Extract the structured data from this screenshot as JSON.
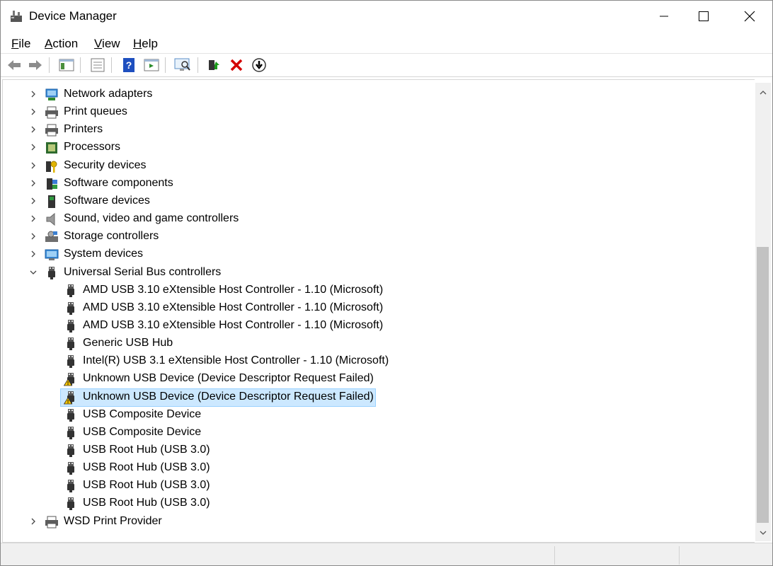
{
  "window": {
    "title": "Device Manager",
    "icon": "device-manager-icon",
    "controls": [
      "minimize",
      "maximize",
      "close"
    ]
  },
  "menu": {
    "file": {
      "label_ul": "F",
      "label_rest": "ile"
    },
    "action": {
      "label_ul": "A",
      "label_rest": "ction"
    },
    "view": {
      "label_ul": "V",
      "label_rest": "iew"
    },
    "help": {
      "label_ul": "H",
      "label_rest": "elp"
    }
  },
  "toolbar": {
    "buttons": [
      "back-icon",
      "forward-icon",
      "show-hide-console-tree-icon",
      "properties-icon",
      "help-icon",
      "action-pane-icon",
      "scan-hardware-icon",
      "update-driver-icon",
      "uninstall-icon",
      "disable-device-icon"
    ]
  },
  "tree": {
    "categories_above": [
      {
        "label": "Network adapters",
        "icon": "network-adapter-icon"
      },
      {
        "label": "Print queues",
        "icon": "printer-icon"
      },
      {
        "label": "Printers",
        "icon": "printer-icon"
      },
      {
        "label": "Processors",
        "icon": "processor-icon"
      },
      {
        "label": "Security devices",
        "icon": "security-key-icon"
      },
      {
        "label": "Software components",
        "icon": "software-component-icon"
      },
      {
        "label": "Software devices",
        "icon": "software-device-icon"
      },
      {
        "label": "Sound, video and game controllers",
        "icon": "speaker-icon"
      },
      {
        "label": "Storage controllers",
        "icon": "storage-controller-icon"
      },
      {
        "label": "System devices",
        "icon": "system-devices-icon"
      }
    ],
    "usb": {
      "label": "Universal Serial Bus controllers",
      "expanded": true,
      "children": [
        {
          "label": "AMD USB 3.10 eXtensible Host Controller - 1.10 (Microsoft)",
          "warning": false
        },
        {
          "label": "AMD USB 3.10 eXtensible Host Controller - 1.10 (Microsoft)",
          "warning": false
        },
        {
          "label": "AMD USB 3.10 eXtensible Host Controller - 1.10 (Microsoft)",
          "warning": false
        },
        {
          "label": "Generic USB Hub",
          "warning": false
        },
        {
          "label": "Intel(R) USB 3.1 eXtensible Host Controller - 1.10 (Microsoft)",
          "warning": false
        },
        {
          "label": "Unknown USB Device (Device Descriptor Request Failed)",
          "warning": true
        },
        {
          "label": "Unknown USB Device (Device Descriptor Request Failed)",
          "warning": true,
          "selected": true
        },
        {
          "label": "USB Composite Device",
          "warning": false
        },
        {
          "label": "USB Composite Device",
          "warning": false
        },
        {
          "label": "USB Root Hub (USB 3.0)",
          "warning": false
        },
        {
          "label": "USB Root Hub (USB 3.0)",
          "warning": false
        },
        {
          "label": "USB Root Hub (USB 3.0)",
          "warning": false
        },
        {
          "label": "USB Root Hub (USB 3.0)",
          "warning": false
        }
      ]
    },
    "categories_below": [
      {
        "label": "WSD Print Provider",
        "icon": "printer-icon"
      }
    ]
  },
  "colors": {
    "selection_bg": "#cce8ff",
    "selection_border": "#99d1ff",
    "warning": "#f5c400",
    "uninstall_red": "#d40000"
  }
}
